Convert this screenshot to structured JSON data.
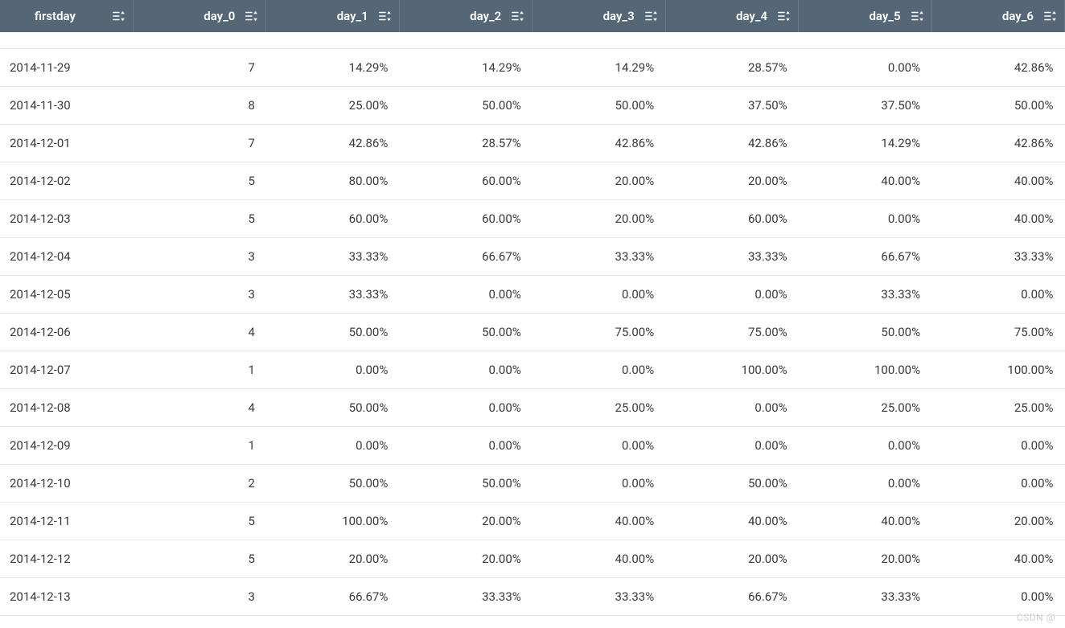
{
  "columns": [
    {
      "key": "firstday",
      "label": "firstday",
      "align": "center"
    },
    {
      "key": "day_0",
      "label": "day_0",
      "align": "right"
    },
    {
      "key": "day_1",
      "label": "day_1",
      "align": "right"
    },
    {
      "key": "day_2",
      "label": "day_2",
      "align": "right"
    },
    {
      "key": "day_3",
      "label": "day_3",
      "align": "right"
    },
    {
      "key": "day_4",
      "label": "day_4",
      "align": "right"
    },
    {
      "key": "day_5",
      "label": "day_5",
      "align": "right"
    },
    {
      "key": "day_6",
      "label": "day_6",
      "align": "right"
    }
  ],
  "header_sort_icon": "sort-icon",
  "rows": [
    {
      "cut": true,
      "firstday": "",
      "day_0": "",
      "day_1": "",
      "day_2": "",
      "day_3": "",
      "day_4": "",
      "day_5": "",
      "day_6": ""
    },
    {
      "cut": false,
      "firstday": "2014-11-29",
      "day_0": "7",
      "day_1": "14.29%",
      "day_2": "14.29%",
      "day_3": "14.29%",
      "day_4": "28.57%",
      "day_5": "0.00%",
      "day_6": "42.86%"
    },
    {
      "cut": false,
      "firstday": "2014-11-30",
      "day_0": "8",
      "day_1": "25.00%",
      "day_2": "50.00%",
      "day_3": "50.00%",
      "day_4": "37.50%",
      "day_5": "37.50%",
      "day_6": "50.00%"
    },
    {
      "cut": false,
      "firstday": "2014-12-01",
      "day_0": "7",
      "day_1": "42.86%",
      "day_2": "28.57%",
      "day_3": "42.86%",
      "day_4": "42.86%",
      "day_5": "14.29%",
      "day_6": "42.86%"
    },
    {
      "cut": false,
      "firstday": "2014-12-02",
      "day_0": "5",
      "day_1": "80.00%",
      "day_2": "60.00%",
      "day_3": "20.00%",
      "day_4": "20.00%",
      "day_5": "40.00%",
      "day_6": "40.00%"
    },
    {
      "cut": false,
      "firstday": "2014-12-03",
      "day_0": "5",
      "day_1": "60.00%",
      "day_2": "60.00%",
      "day_3": "20.00%",
      "day_4": "60.00%",
      "day_5": "0.00%",
      "day_6": "40.00%"
    },
    {
      "cut": false,
      "firstday": "2014-12-04",
      "day_0": "3",
      "day_1": "33.33%",
      "day_2": "66.67%",
      "day_3": "33.33%",
      "day_4": "33.33%",
      "day_5": "66.67%",
      "day_6": "33.33%"
    },
    {
      "cut": false,
      "firstday": "2014-12-05",
      "day_0": "3",
      "day_1": "33.33%",
      "day_2": "0.00%",
      "day_3": "0.00%",
      "day_4": "0.00%",
      "day_5": "33.33%",
      "day_6": "0.00%"
    },
    {
      "cut": false,
      "firstday": "2014-12-06",
      "day_0": "4",
      "day_1": "50.00%",
      "day_2": "50.00%",
      "day_3": "75.00%",
      "day_4": "75.00%",
      "day_5": "50.00%",
      "day_6": "75.00%"
    },
    {
      "cut": false,
      "firstday": "2014-12-07",
      "day_0": "1",
      "day_1": "0.00%",
      "day_2": "0.00%",
      "day_3": "0.00%",
      "day_4": "100.00%",
      "day_5": "100.00%",
      "day_6": "100.00%"
    },
    {
      "cut": false,
      "firstday": "2014-12-08",
      "day_0": "4",
      "day_1": "50.00%",
      "day_2": "0.00%",
      "day_3": "25.00%",
      "day_4": "0.00%",
      "day_5": "25.00%",
      "day_6": "25.00%"
    },
    {
      "cut": false,
      "firstday": "2014-12-09",
      "day_0": "1",
      "day_1": "0.00%",
      "day_2": "0.00%",
      "day_3": "0.00%",
      "day_4": "0.00%",
      "day_5": "0.00%",
      "day_6": "0.00%"
    },
    {
      "cut": false,
      "firstday": "2014-12-10",
      "day_0": "2",
      "day_1": "50.00%",
      "day_2": "50.00%",
      "day_3": "0.00%",
      "day_4": "50.00%",
      "day_5": "0.00%",
      "day_6": "0.00%"
    },
    {
      "cut": false,
      "firstday": "2014-12-11",
      "day_0": "5",
      "day_1": "100.00%",
      "day_2": "20.00%",
      "day_3": "40.00%",
      "day_4": "40.00%",
      "day_5": "40.00%",
      "day_6": "20.00%"
    },
    {
      "cut": false,
      "firstday": "2014-12-12",
      "day_0": "5",
      "day_1": "20.00%",
      "day_2": "20.00%",
      "day_3": "40.00%",
      "day_4": "20.00%",
      "day_5": "20.00%",
      "day_6": "40.00%"
    },
    {
      "cut": false,
      "firstday": "2014-12-13",
      "day_0": "3",
      "day_1": "66.67%",
      "day_2": "33.33%",
      "day_3": "33.33%",
      "day_4": "66.67%",
      "day_5": "33.33%",
      "day_6": "0.00%"
    }
  ],
  "watermark": "CSDN @"
}
